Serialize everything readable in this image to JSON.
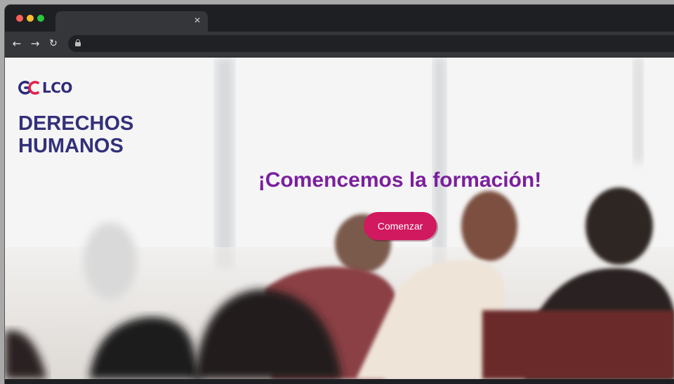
{
  "browser": {
    "tab_close_icon": "✕",
    "back_icon": "←",
    "forward_icon": "→",
    "reload_icon": "↻",
    "url": ""
  },
  "page": {
    "logo_text": "LCO",
    "title_line1": "DERECHOS",
    "title_line2": "HUMANOS",
    "heading": "¡Comencemos la formación!",
    "cta_label": "Comenzar"
  },
  "colors": {
    "brand_navy": "#33307a",
    "heading_purple": "#7b1f9e",
    "cta_pink": "#d0195f"
  }
}
